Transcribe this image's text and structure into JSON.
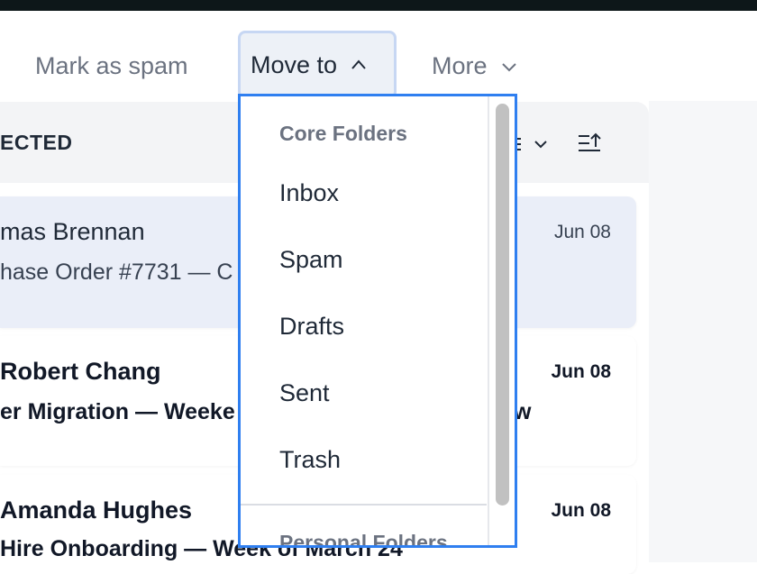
{
  "toolbar": {
    "mark_spam": "Mark as spam",
    "move_to": "Move to",
    "more": "More"
  },
  "list_header": {
    "label": "ECTED"
  },
  "emails": [
    {
      "sender": "mas Brennan",
      "subject": "hase Order #7731 — C",
      "date": "Jun 08",
      "unread": false,
      "selected": true
    },
    {
      "sender": "Robert Chang",
      "subject": "er Migration — Weeke",
      "date": "Jun 08",
      "unread": true,
      "selected": false
    },
    {
      "sender": "Amanda Hughes",
      "subject": "Hire Onboarding — Week of March 24",
      "date": "Jun 08",
      "unread": true,
      "selected": false
    }
  ],
  "extra_text": {
    "row2_overflow": "w"
  },
  "move_menu": {
    "core_heading": "Core Folders",
    "items": [
      "Inbox",
      "Spam",
      "Drafts",
      "Sent",
      "Trash"
    ],
    "personal_heading": "Personal Folders"
  },
  "colors": {
    "accent_border": "#2f7ff0",
    "selected_row": "#eaeef8"
  }
}
